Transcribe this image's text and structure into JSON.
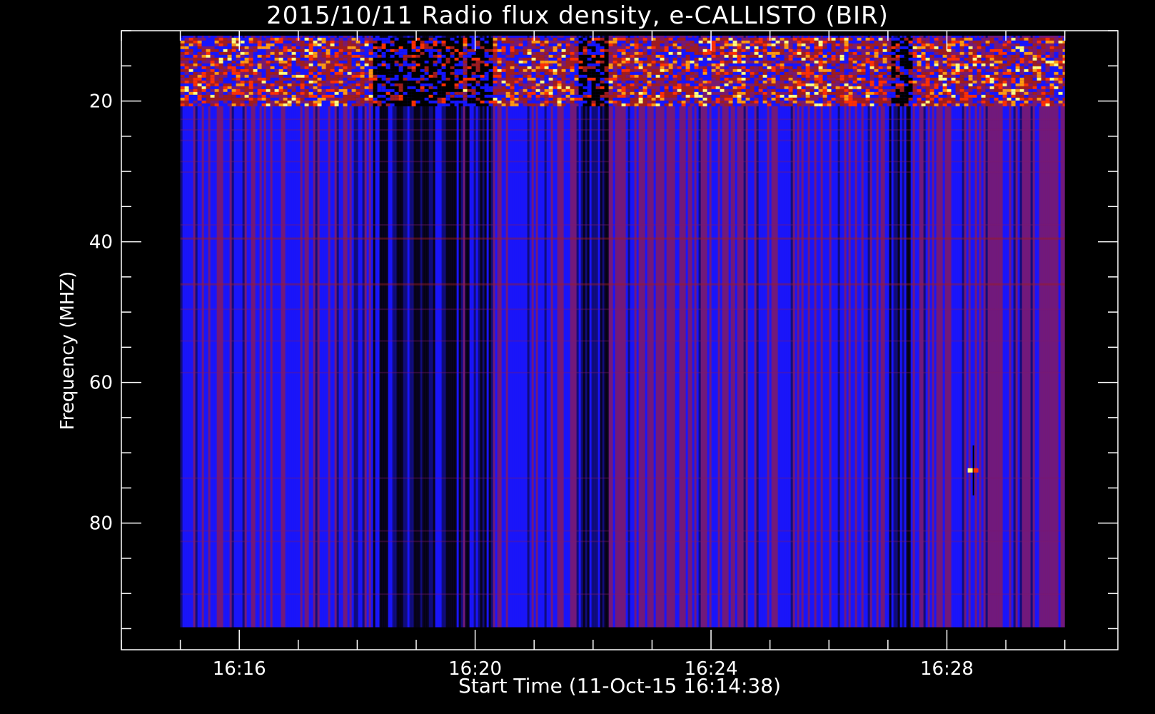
{
  "chart_data": {
    "type": "heatmap",
    "title": "2015/10/11  Radio flux density, e-CALLISTO (BIR)",
    "xlabel": "Start Time (11-Oct-15 16:14:38)",
    "ylabel": "Frequency (MHZ)",
    "x_axis": {
      "unit": "minutes after 16:00",
      "range": [
        14.0,
        30.9
      ],
      "data_range": [
        15.0,
        30.0
      ],
      "major_ticks": [
        {
          "value": 16,
          "label": "16:16"
        },
        {
          "value": 20,
          "label": "16:20"
        },
        {
          "value": 24,
          "label": "16:24"
        },
        {
          "value": 28,
          "label": "16:28"
        }
      ],
      "minor_step": 1
    },
    "y_axis": {
      "range": [
        10,
        98
      ],
      "data_range": [
        10.7,
        94.8
      ],
      "inverted": true,
      "major_ticks": [
        20,
        40,
        60,
        80
      ],
      "minor_step": 5
    },
    "colormap": [
      "#000000",
      "#0a0a6e",
      "#1515ff",
      "#7a1a6e",
      "#a01c1c",
      "#ff3000",
      "#ff9a10",
      "#ffff80"
    ],
    "features": {
      "dark_interference_bands_min": [
        [
          18.25,
          19.75
        ],
        [
          19.8,
          20.3
        ],
        [
          21.7,
          22.25
        ],
        [
          27.0,
          27.35
        ]
      ],
      "bright_rfi_band_mhz": [
        11,
        20.5
      ],
      "burst_spike": {
        "time_min": 28.45,
        "freq_mhz": 72.5
      },
      "faint_lines_mhz": [
        39.5,
        46
      ]
    }
  }
}
